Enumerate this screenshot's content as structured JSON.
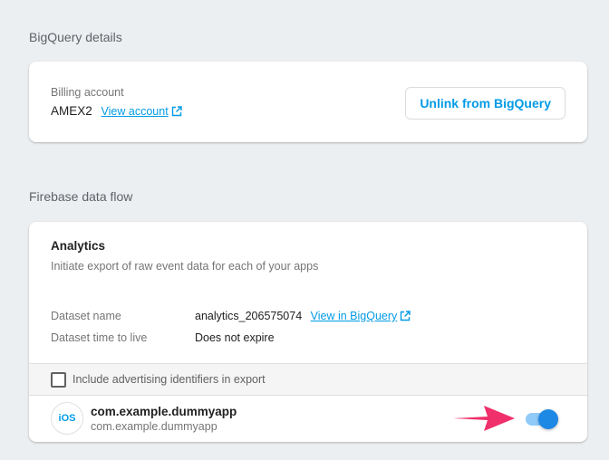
{
  "bigquery_details": {
    "section_title": "BigQuery details",
    "billing_label": "Billing account",
    "billing_value": "AMEX2",
    "view_account_link": "View account",
    "unlink_button": "Unlink from BigQuery"
  },
  "data_flow": {
    "section_title": "Firebase data flow",
    "analytics": {
      "title": "Analytics",
      "description": "Initiate export of raw event data for each of your apps",
      "dataset_name_label": "Dataset name",
      "dataset_name_value": "analytics_206575074",
      "view_in_bigquery_link": "View in BigQuery",
      "ttl_label": "Dataset time to live",
      "ttl_value": "Does not expire",
      "checkbox_label": "Include advertising identifiers in export",
      "checkbox_checked": false
    },
    "app": {
      "platform_icon": "iOS",
      "name": "com.example.dummyapp",
      "bundle_id": "com.example.dummyapp",
      "export_enabled": true
    }
  },
  "colors": {
    "accent": "#039be5",
    "toggle_on": "#1e88e5",
    "annotation_arrow": "#f0306a",
    "background": "#eceff1"
  }
}
